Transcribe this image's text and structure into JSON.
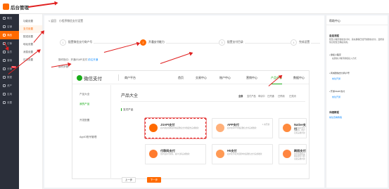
{
  "app": {
    "title": "后台管理"
  },
  "sidebar": {
    "items": [
      {
        "label": "概况",
        "active": false
      },
      {
        "label": "店铺",
        "active": false
      },
      {
        "label": "商品",
        "active": false
      },
      {
        "label": "订单",
        "active": false
      },
      {
        "label": "会员",
        "active": false
      },
      {
        "label": "营销",
        "active": false
      },
      {
        "label": "分销",
        "active": false,
        "badge": "New"
      },
      {
        "label": "数据",
        "active": false
      },
      {
        "label": "资产",
        "active": false
      },
      {
        "label": "应用",
        "active": false
      },
      {
        "label": "设置",
        "active": false
      }
    ],
    "active_color": "#ff6a00"
  },
  "subnav": {
    "items": [
      {
        "label": "功能设置",
        "active": false
      },
      {
        "label": "支付设置",
        "active": true
      },
      {
        "label": "配送设置",
        "active": false
      },
      {
        "label": "地址设置",
        "active": false
      },
      {
        "label": "消息设置",
        "active": false
      },
      {
        "label": "日志设置",
        "active": false
      }
    ]
  },
  "main": {
    "breadcrumb": {
      "back": "< 返回",
      "current": "小程序微信支付设置"
    },
    "steps": [
      {
        "num": "1",
        "label": "配置微信支付商户号",
        "active": false
      },
      {
        "num": "2",
        "label": "开通支付能力",
        "active": true
      },
      {
        "num": "3",
        "label": "配置支付目录",
        "active": false
      },
      {
        "num": "4",
        "label": "完成设置",
        "active": false
      }
    ],
    "guide_prefix": "操作指引：开通JSAPI支付",
    "guide_link": "前往开通",
    "guide_sub": "操作步骤：",
    "prev_label": "上一步",
    "next_label": "下一步"
  },
  "wechatpay": {
    "logo_text": "微信支付",
    "platform": "商户平台",
    "nav": [
      {
        "label": "首页",
        "active": false
      },
      {
        "label": "交易中心",
        "active": false
      },
      {
        "label": "账户中心",
        "active": false
      },
      {
        "label": "营销中心",
        "active": false
      },
      {
        "label": "产品中心",
        "active": true
      },
      {
        "label": "数据中心",
        "active": false
      }
    ],
    "side": [
      {
        "label": "产品大全",
        "active": false
      },
      {
        "label": "我的产品",
        "active": true
      },
      {
        "label": "开发配置",
        "active": false
      },
      {
        "label": "AppID账号管理",
        "active": false
      }
    ],
    "title": "产品大全",
    "filters": [
      {
        "label": "全部",
        "active": true
      },
      {
        "label": "支付产品",
        "active": false
      },
      {
        "label": "申请中",
        "active": false
      },
      {
        "label": "已开通",
        "active": false
      },
      {
        "label": "已停用",
        "active": false
      },
      {
        "label": "已关闭",
        "active": false
      }
    ],
    "category": "支付产品",
    "products": [
      {
        "name": "JSAPI支付",
        "desc": "商户通过在网页内拉起微信支付收银台完成收款",
        "status": "",
        "color": "#ff6a00",
        "highlight": true
      },
      {
        "name": "APP支付",
        "desc": "商户在APP中拉起微信支付完成收款",
        "status": "1 未开通",
        "color": "#ff6a00",
        "highlight": false
      },
      {
        "name": "Native支付",
        "desc": "商户展示支付二维码，用户扫码完成付款",
        "status": "1 未开通",
        "color": "#ff6a00",
        "highlight": false
      },
      {
        "name": "付款码支付",
        "desc": "用户展示付款码，商户扫码完成收款",
        "status": "",
        "color": "#ff6a00",
        "highlight": false
      },
      {
        "name": "H5支付",
        "desc": "商户在手机浏览器中拉起微信支付完成收款",
        "status": "",
        "color": "#ff6a00",
        "highlight": false
      },
      {
        "name": "刷脸支付",
        "desc": "用户在刷脸设备前通过人脸识别完成付款",
        "status": "",
        "color": "#ff6a00",
        "highlight": false
      }
    ]
  },
  "help": {
    "title": "帮助中心",
    "section1": "自连流程",
    "section1_text": "配置小程序微信支付时，需先确保已经开通微信支付，且所需信息配置正确后完成。",
    "q1": "• 授权小程序",
    "q1_sub": "在微信小程序授权接入方式",
    "q2": "• 商城微信支付商户号",
    "q2_link": "前往开通",
    "q3": "• 开通JSAPI支付",
    "q3_link": "前往开通",
    "section2": "详细教程",
    "section2_link": "前往查看教程"
  }
}
